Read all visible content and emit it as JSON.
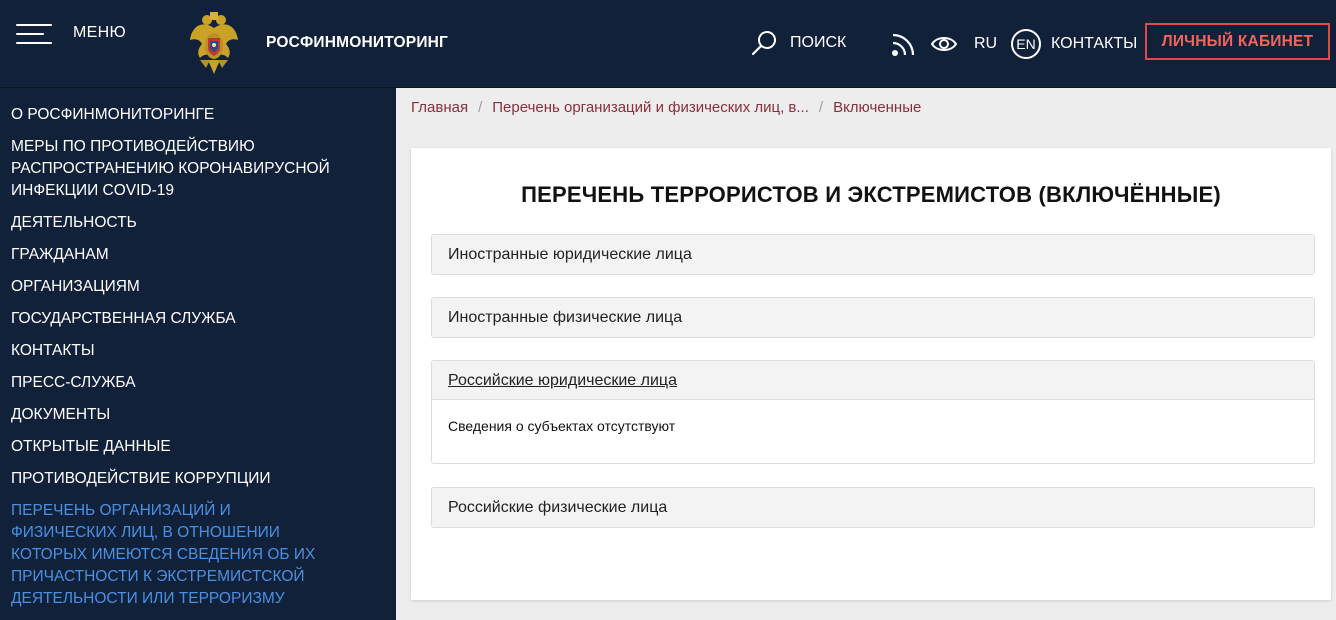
{
  "header": {
    "menu_label": "МЕНЮ",
    "brand": "РОСФИНМОНИТОРИНГ",
    "search_label": "ПОИСК",
    "lang_ru": "RU",
    "lang_en": "EN",
    "contacts": "КОНТАКТЫ",
    "cabinet": "ЛИЧНЫЙ КАБИНЕТ"
  },
  "sidebar": {
    "items": [
      {
        "label": "О РОСФИНМОНИТОРИНГЕ"
      },
      {
        "label": "МЕРЫ ПО ПРОТИВОДЕЙСТВИЮ РАСПРОСТРАНЕНИЮ КОРОНАВИРУСНОЙ ИНФЕКЦИИ COVID-19"
      },
      {
        "label": "ДЕЯТЕЛЬНОСТЬ"
      },
      {
        "label": "ГРАЖДАНАМ"
      },
      {
        "label": "ОРГАНИЗАЦИЯМ"
      },
      {
        "label": "ГОСУДАРСТВЕННАЯ СЛУЖБА"
      },
      {
        "label": "КОНТАКТЫ"
      },
      {
        "label": "ПРЕСС-СЛУЖБА"
      },
      {
        "label": "ДОКУМЕНТЫ"
      },
      {
        "label": "ОТКРЫТЫЕ ДАННЫЕ"
      },
      {
        "label": "ПРОТИВОДЕЙСТВИЕ КОРРУПЦИИ"
      },
      {
        "label": "ПЕРЕЧЕНЬ ОРГАНИЗАЦИЙ И ФИЗИЧЕСКИХ ЛИЦ, В ОТНОШЕНИИ КОТОРЫХ ИМЕЮТСЯ СВЕДЕНИЯ ОБ ИХ ПРИЧАСТНОСТИ К ЭКСТРЕМИСТСКОЙ ДЕЯТЕЛЬНОСТИ ИЛИ ТЕРРОРИЗМУ"
      }
    ]
  },
  "breadcrumb": {
    "home": "Главная",
    "parent": "Перечень организаций и физических лиц, в...",
    "current": "Включенные",
    "separator": "/"
  },
  "main": {
    "title": "ПЕРЕЧЕНЬ ТЕРРОРИСТОВ И ЭКСТРЕМИСТОВ (ВКЛЮЧЁННЫЕ)",
    "sections": [
      {
        "label": "Иностранные юридические лица"
      },
      {
        "label": "Иностранные физические лица"
      },
      {
        "label": "Российские юридические лица",
        "body": "Сведения о субъектах отсутствуют"
      },
      {
        "label": "Российские физические лица"
      }
    ]
  },
  "colors": {
    "header_bg": "#12213a",
    "accent_red": "#e04a4a",
    "active_nav": "#4a90e2",
    "breadcrumb": "#8a2f3e"
  },
  "icons": [
    "hamburger-icon",
    "emblem-logo",
    "search-icon",
    "rss-icon",
    "eye-icon"
  ]
}
